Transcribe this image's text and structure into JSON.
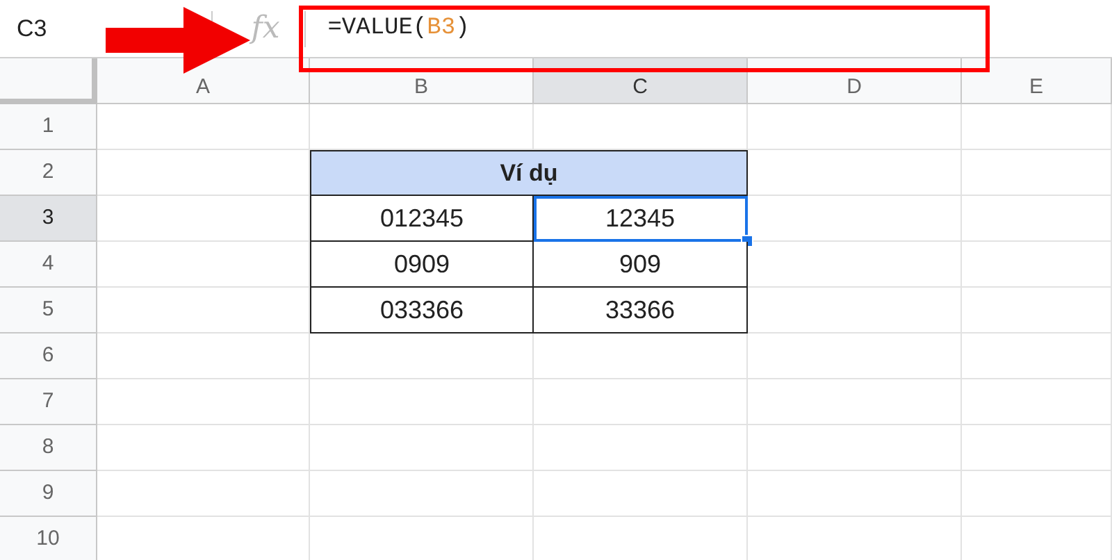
{
  "name_box": "C3",
  "fx_label": "fx",
  "formula": {
    "text_before": "=VALUE(",
    "reference": "B3",
    "text_after": ")"
  },
  "columns": [
    {
      "label": "A",
      "selected": false
    },
    {
      "label": "B",
      "selected": false
    },
    {
      "label": "C",
      "selected": true
    },
    {
      "label": "D",
      "selected": false
    },
    {
      "label": "E",
      "selected": false
    }
  ],
  "rows": [
    {
      "label": "1",
      "selected": false
    },
    {
      "label": "2",
      "selected": false
    },
    {
      "label": "3",
      "selected": true
    },
    {
      "label": "4",
      "selected": false
    },
    {
      "label": "5",
      "selected": false
    },
    {
      "label": "6",
      "selected": false
    },
    {
      "label": "7",
      "selected": false
    },
    {
      "label": "8",
      "selected": false
    },
    {
      "label": "9",
      "selected": false
    },
    {
      "label": "10",
      "selected": false
    }
  ],
  "example_table": {
    "title": "Ví dụ",
    "rows": [
      {
        "original": "012345",
        "converted": "12345",
        "selected": true
      },
      {
        "original": "0909",
        "converted": "909",
        "selected": false
      },
      {
        "original": "033366",
        "converted": "33366",
        "selected": false
      }
    ]
  }
}
